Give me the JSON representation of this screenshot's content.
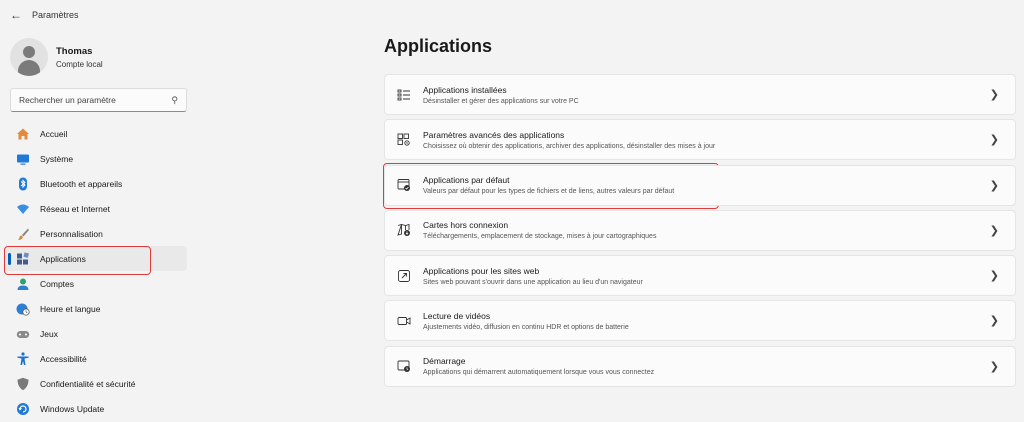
{
  "window": {
    "title": "Paramètres"
  },
  "profile": {
    "name": "Thomas",
    "account_type": "Compte local"
  },
  "search": {
    "placeholder": "Rechercher un paramètre"
  },
  "nav": [
    {
      "label": "Accueil",
      "icon": "home-icon",
      "color": "#e38a3e"
    },
    {
      "label": "Système",
      "icon": "monitor-icon",
      "color": "#1f7ad6"
    },
    {
      "label": "Bluetooth et appareils",
      "icon": "bluetooth-icon",
      "color": "#1f7ad6"
    },
    {
      "label": "Réseau et Internet",
      "icon": "wifi-icon",
      "color": "#3a8ee6"
    },
    {
      "label": "Personnalisation",
      "icon": "brush-icon",
      "color": "#d98b3a"
    },
    {
      "label": "Applications",
      "icon": "apps-icon",
      "color": "#3f5f8a",
      "active": true
    },
    {
      "label": "Comptes",
      "icon": "person-icon",
      "color": "#2aa36b"
    },
    {
      "label": "Heure et langue",
      "icon": "globe-clock-icon",
      "color": "#2b7fd4"
    },
    {
      "label": "Jeux",
      "icon": "gamepad-icon",
      "color": "#8a8a8a"
    },
    {
      "label": "Accessibilité",
      "icon": "accessibility-icon",
      "color": "#1f6fd1"
    },
    {
      "label": "Confidentialité et sécurité",
      "icon": "shield-icon",
      "color": "#7a7a7a"
    },
    {
      "label": "Windows Update",
      "icon": "update-icon",
      "color": "#1f7ad6"
    }
  ],
  "main": {
    "title": "Applications",
    "cards": [
      {
        "title": "Applications installées",
        "desc": "Désinstaller et gérer des applications sur votre PC",
        "icon": "list-icon"
      },
      {
        "title": "Paramètres avancés des applications",
        "desc": "Choisissez où obtenir des applications, archiver des applications, désinstaller des mises à jour",
        "icon": "apps-gear-icon"
      },
      {
        "title": "Applications par défaut",
        "desc": "Valeurs par défaut pour les types de fichiers et de liens, autres valeurs par défaut",
        "icon": "default-apps-icon"
      },
      {
        "title": "Cartes hors connexion",
        "desc": "Téléchargements, emplacement de stockage, mises à jour cartographiques",
        "icon": "map-download-icon"
      },
      {
        "title": "Applications pour les sites web",
        "desc": "Sites web pouvant s'ouvrir dans une application au lieu d'un navigateur",
        "icon": "open-external-icon"
      },
      {
        "title": "Lecture de vidéos",
        "desc": "Ajustements vidéo, diffusion en continu HDR et options de batterie",
        "icon": "video-icon"
      },
      {
        "title": "Démarrage",
        "desc": "Applications qui démarrent automatiquement lorsque vous vous connectez",
        "icon": "startup-icon"
      }
    ]
  },
  "colors": {
    "accent": "#005fb8",
    "highlight": "#e03b3b"
  }
}
